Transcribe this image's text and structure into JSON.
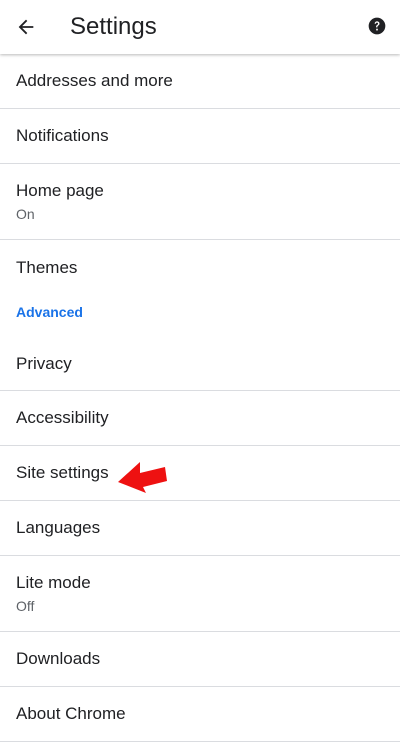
{
  "appbar": {
    "title": "Settings",
    "back_icon": "arrow-back-icon",
    "help_icon": "help-icon"
  },
  "items": [
    {
      "title": "Addresses and more"
    },
    {
      "title": "Notifications"
    },
    {
      "title": "Home page",
      "subtitle": "On"
    },
    {
      "title": "Themes"
    }
  ],
  "advanced": {
    "header": "Advanced",
    "items": [
      {
        "title": "Privacy"
      },
      {
        "title": "Accessibility"
      },
      {
        "title": "Site settings"
      },
      {
        "title": "Languages"
      },
      {
        "title": "Lite mode",
        "subtitle": "Off"
      },
      {
        "title": "Downloads"
      },
      {
        "title": "About Chrome"
      }
    ]
  },
  "colors": {
    "accent": "#1a73e8",
    "annotation_arrow": "#ee1111",
    "divider": "#dadce0"
  }
}
